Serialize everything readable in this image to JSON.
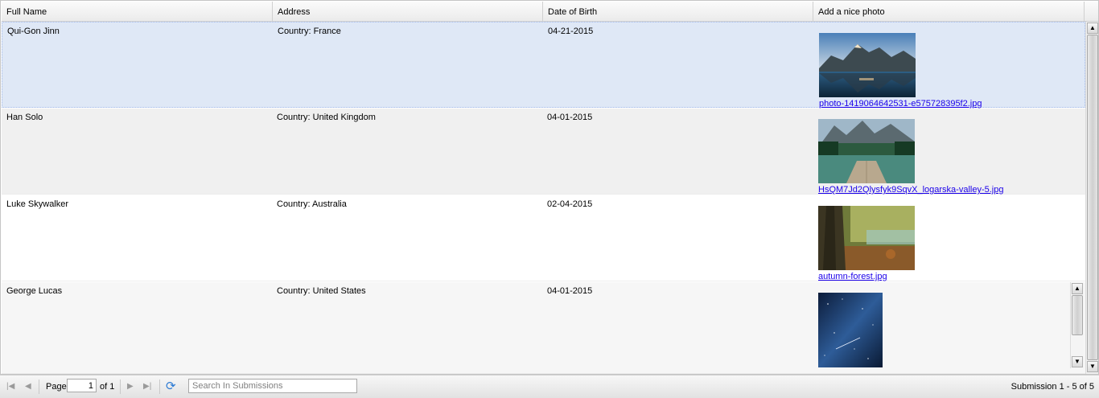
{
  "columns": {
    "full_name": "Full Name",
    "address": "Address",
    "dob": "Date of Birth",
    "photo": "Add a nice photo"
  },
  "rows": [
    {
      "name": "Qui-Gon Jinn",
      "address": "Country: France",
      "dob": "04-21-2015",
      "photo_file": "photo-1419064642531-e575728395f2.jpg",
      "photo_icon": "mountain-lake-photo"
    },
    {
      "name": "Han Solo",
      "address": "Country: United Kingdom",
      "dob": "04-01-2015",
      "photo_file": "HsQM7Jd2Qlysfyk9SqvX_logarska-valley-5.jpg",
      "photo_icon": "lake-dock-photo"
    },
    {
      "name": "Luke Skywalker",
      "address": "Country: Australia",
      "dob": "02-04-2015",
      "photo_file": "autumn-forest.jpg",
      "photo_icon": "autumn-forest-photo"
    },
    {
      "name": "George Lucas",
      "address": "Country: United States",
      "dob": "04-01-2015",
      "photo_file": "",
      "photo_icon": "night-sky-photo"
    }
  ],
  "pager": {
    "page_label": "Page",
    "page_value": "1",
    "of_label": "of 1",
    "search_placeholder": "Search In Submissions",
    "summary": "Submission 1 - 5 of 5"
  },
  "colors": {
    "selected_row": "#dfe8f6",
    "link": "#1b00ea",
    "alt_row": "#f0f0f0"
  }
}
